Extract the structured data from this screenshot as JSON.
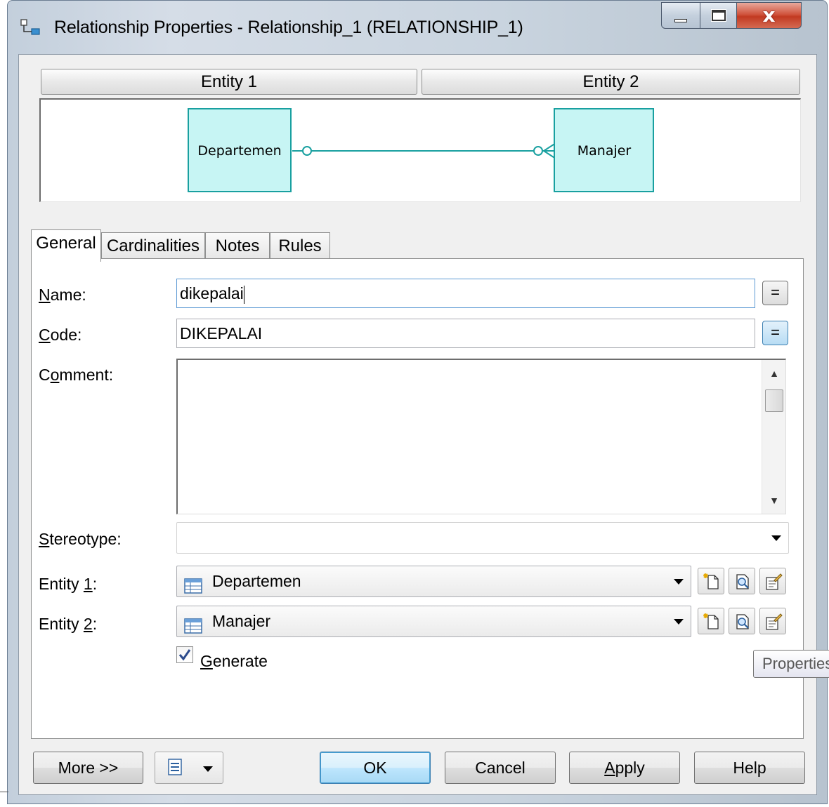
{
  "window": {
    "title": "Relationship Properties - Relationship_1 (RELATIONSHIP_1)",
    "minimize_label": "Minimize",
    "maximize_label": "Maximize",
    "close_label": "x"
  },
  "header": {
    "entity1_label": "Entity 1",
    "entity2_label": "Entity 2"
  },
  "diagram": {
    "entity1_name": "Departemen",
    "entity2_name": "Manajer",
    "entity_fill": "#c7f5f4",
    "entity_stroke": "#19a0a0",
    "line_color": "#19a0a0"
  },
  "tabs": [
    {
      "label": "General",
      "active": true
    },
    {
      "label": "Cardinalities",
      "active": false
    },
    {
      "label": "Notes",
      "active": false
    },
    {
      "label": "Rules",
      "active": false
    }
  ],
  "form": {
    "name_label_ul": "N",
    "name_label_rest": "ame:",
    "name_value": "dikepalai",
    "code_label_ul": "C",
    "code_label_rest": "ode:",
    "code_value": "DIKEPALAI",
    "comment_label_pre": "C",
    "comment_label_ul": "o",
    "comment_label_rest": "mment:",
    "comment_value": "",
    "stereotype_label_ul": "S",
    "stereotype_label_rest": "tereotype:",
    "stereotype_value": "",
    "entity1_label_pre": "Entity ",
    "entity1_label_ul": "1",
    "entity1_label_rest": ":",
    "entity1_value": "Departemen",
    "entity2_label_pre": "Entity ",
    "entity2_label_ul": "2",
    "entity2_label_rest": ":",
    "entity2_value": "Manajer",
    "equals_symbol": "=",
    "generate_label_ul": "G",
    "generate_label_rest": "enerate",
    "generate_checked": true
  },
  "tooltip": {
    "text": "Properties"
  },
  "buttons": {
    "more": "More >>",
    "ok": "OK",
    "cancel": "Cancel",
    "apply_ul": "A",
    "apply_rest": "pply",
    "help": "Help"
  },
  "icons": {
    "title": "relationship-icon",
    "entity_combo": "entity-table-icon",
    "create": "create-icon",
    "browse": "browse-icon",
    "properties": "properties-icon",
    "menu": "menu-list-icon"
  }
}
